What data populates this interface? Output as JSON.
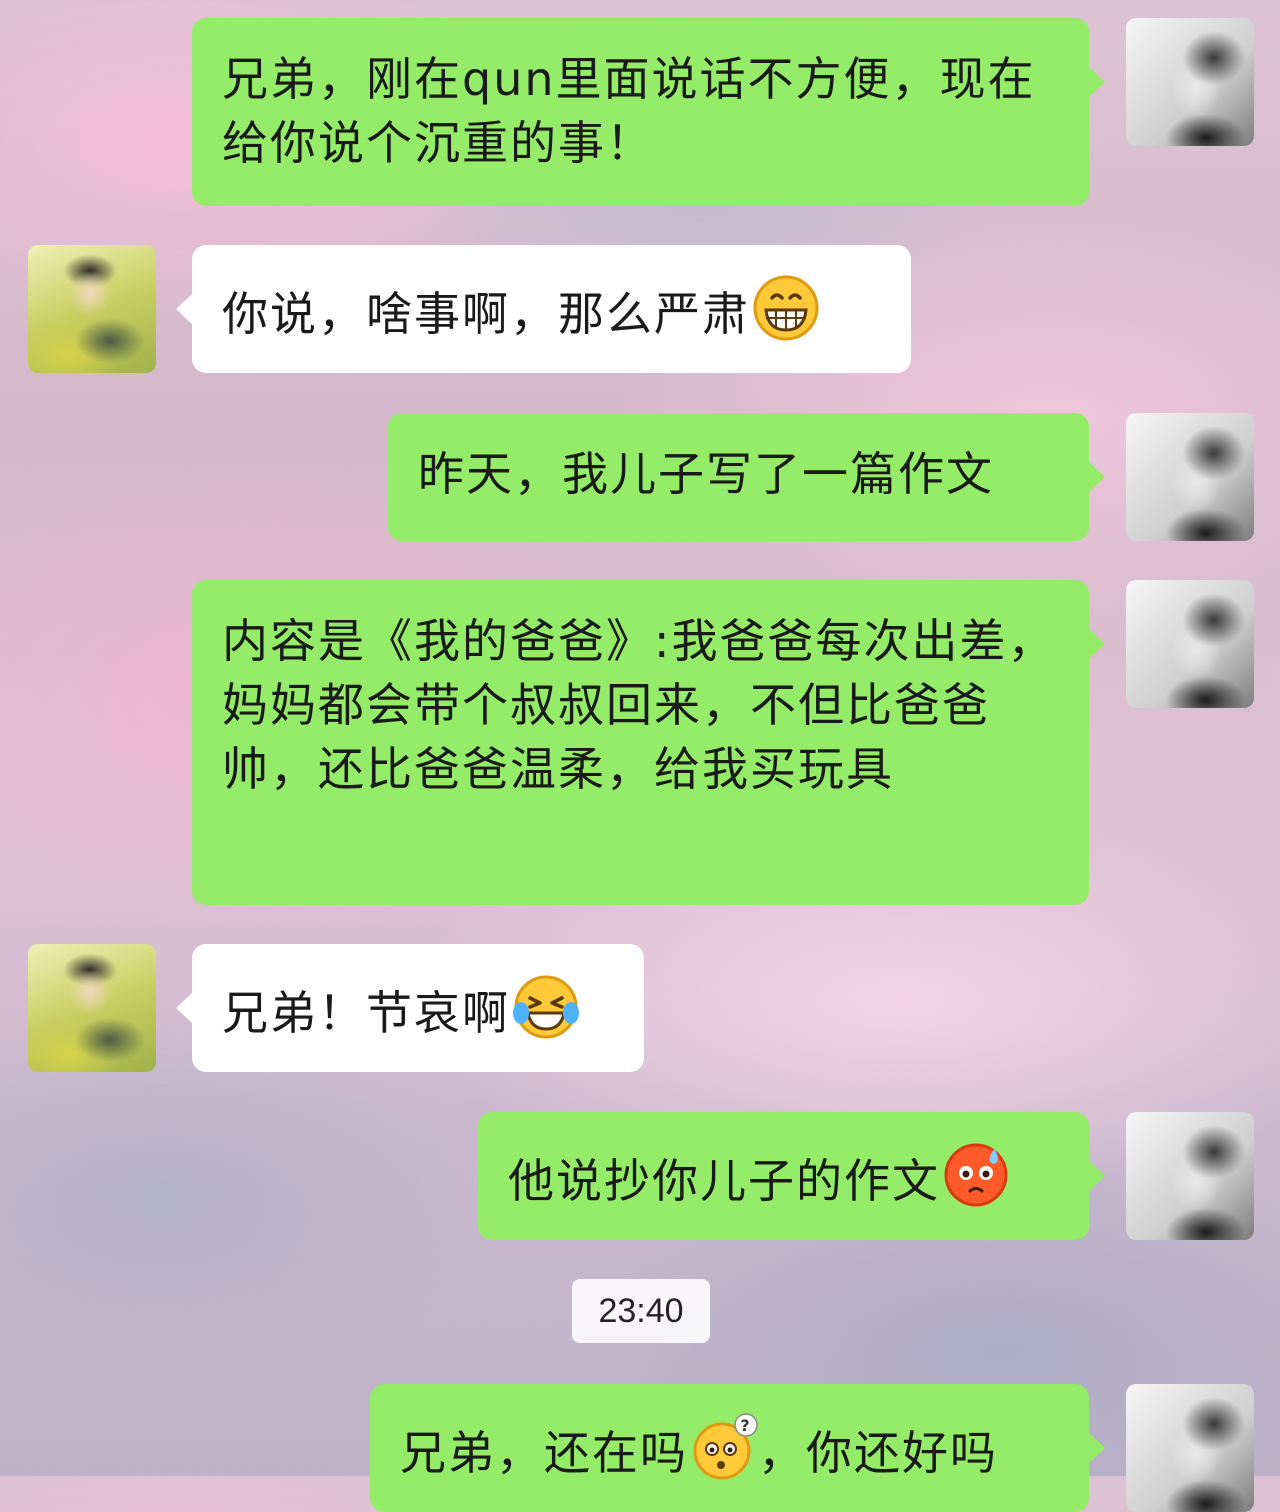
{
  "messages": [
    {
      "sender": "self",
      "text": "兄弟，刚在qun里面说话不方便，现在给你说个沉重的事！"
    },
    {
      "sender": "friend",
      "text": "你说，啥事啊，那么严肃",
      "emoji": "grinning-face"
    },
    {
      "sender": "self",
      "text": "昨天，我儿子写了一篇作文"
    },
    {
      "sender": "self",
      "text": "内容是《我的爸爸》:我爸爸每次出差，妈妈都会带个叔叔回来，不但比爸爸帅，还比爸爸温柔，给我买玩具"
    },
    {
      "sender": "friend",
      "text": "兄弟！节哀啊",
      "emoji": "laughing-tears-face"
    },
    {
      "sender": "self",
      "text": "他说抄你儿子的作文",
      "emoji": "flushed-sweat-face"
    },
    {
      "sender": "self",
      "text": "兄弟，还在吗",
      "emoji": "confused-question-face",
      "text_after": "，你还好吗"
    }
  ],
  "timestamp": "23:40"
}
